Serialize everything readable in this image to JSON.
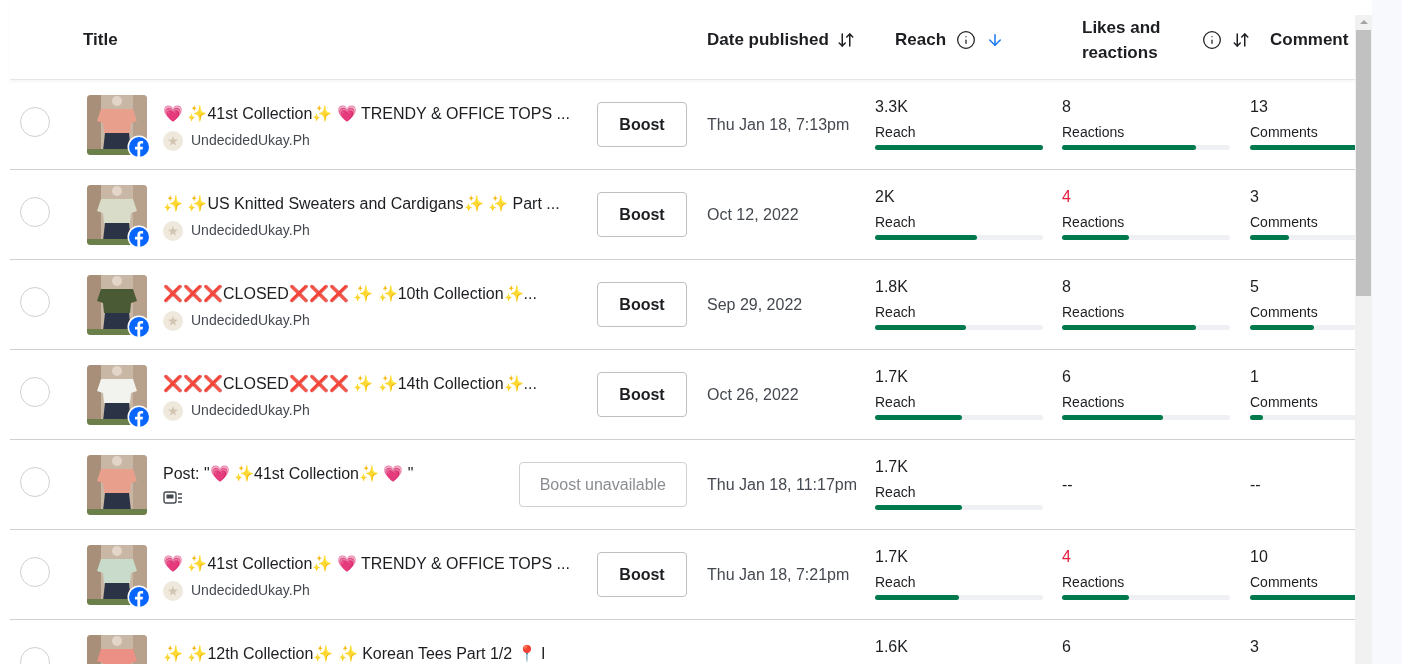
{
  "columns": [
    {
      "label": "Title",
      "kind": "plain"
    },
    {
      "label": "Date published",
      "kind": "sortable",
      "sorted": false
    },
    {
      "label": "Reach",
      "kind": "info_sortable",
      "sorted": true
    },
    {
      "label": "Likes and reactions",
      "kind": "info_sortable",
      "sorted": false
    },
    {
      "label": "Comment",
      "kind": "plain"
    }
  ],
  "rows": [
    {
      "kind": "post",
      "selected": false,
      "title": "💗 ✨41st Collection✨ 💗  TRENDY & OFFICE TOPS ...",
      "page": "UndecidedUkay.Ph",
      "boost": {
        "label": "Boost",
        "disabled": false
      },
      "date": "Thu Jan 18, 7:13pm",
      "reach": {
        "value": "3.3K",
        "label": "Reach",
        "level": 1.0
      },
      "likes": {
        "value": "8",
        "label": "Reactions",
        "level": 0.8,
        "color": "#1c1e21"
      },
      "comments": {
        "value": "13",
        "label": "Comments",
        "level": 1.0
      }
    },
    {
      "kind": "post",
      "selected": false,
      "title": "✨ ✨US Knitted Sweaters and Cardigans✨ ✨  Part ...",
      "page": "UndecidedUkay.Ph",
      "boost": {
        "label": "Boost",
        "disabled": false
      },
      "date": "Oct 12, 2022",
      "reach": {
        "value": "2K",
        "label": "Reach",
        "level": 0.61
      },
      "likes": {
        "value": "4",
        "label": "Reactions",
        "level": 0.4,
        "color": "#e41e3f"
      },
      "comments": {
        "value": "3",
        "label": "Comments",
        "level": 0.23
      }
    },
    {
      "kind": "post",
      "selected": false,
      "title": "❌❌❌CLOSED❌❌❌  ✨ ✨10th Collection✨...",
      "page": "UndecidedUkay.Ph",
      "boost": {
        "label": "Boost",
        "disabled": false
      },
      "date": "Sep 29, 2022",
      "reach": {
        "value": "1.8K",
        "label": "Reach",
        "level": 0.54
      },
      "likes": {
        "value": "8",
        "label": "Reactions",
        "level": 0.8,
        "color": "#1c1e21"
      },
      "comments": {
        "value": "5",
        "label": "Comments",
        "level": 0.38
      }
    },
    {
      "kind": "post",
      "selected": false,
      "title": "❌❌❌CLOSED❌❌❌  ✨ ✨14th Collection✨...",
      "page": "UndecidedUkay.Ph",
      "boost": {
        "label": "Boost",
        "disabled": false
      },
      "date": "Oct 26, 2022",
      "reach": {
        "value": "1.7K",
        "label": "Reach",
        "level": 0.52
      },
      "likes": {
        "value": "6",
        "label": "Reactions",
        "level": 0.6,
        "color": "#1c1e21"
      },
      "comments": {
        "value": "1",
        "label": "Comments",
        "level": 0.08
      }
    },
    {
      "kind": "reel",
      "selected": false,
      "title": "Post: \"💗 ✨41st Collection✨ 💗 \"",
      "boost": {
        "label": "Boost unavailable",
        "disabled": true
      },
      "date": "Thu Jan 18, 11:17pm",
      "reach": {
        "value": "1.7K",
        "label": "Reach",
        "level": 0.52
      },
      "likes": {
        "kind": "empty",
        "value": "--"
      },
      "comments": {
        "kind": "empty",
        "value": "--"
      }
    },
    {
      "kind": "post",
      "selected": false,
      "title": "💗 ✨41st Collection✨ 💗  TRENDY & OFFICE TOPS ...",
      "page": "UndecidedUkay.Ph",
      "boost": {
        "label": "Boost",
        "disabled": false
      },
      "date": "Thu Jan 18, 7:21pm",
      "reach": {
        "value": "1.7K",
        "label": "Reach",
        "level": 0.5
      },
      "likes": {
        "value": "4",
        "label": "Reactions",
        "level": 0.4,
        "color": "#e41e3f"
      },
      "comments": {
        "value": "10",
        "label": "Comments",
        "level": 0.77
      }
    },
    {
      "kind": "post",
      "selected": false,
      "title": "✨ ✨12th Collection✨ ✨  Korean Tees Part 1/2 📍 I",
      "reach": {
        "value": "1.6K"
      },
      "likes": {
        "value": "6",
        "color": "#1c1e21"
      },
      "comments": {
        "value": "3"
      }
    }
  ]
}
